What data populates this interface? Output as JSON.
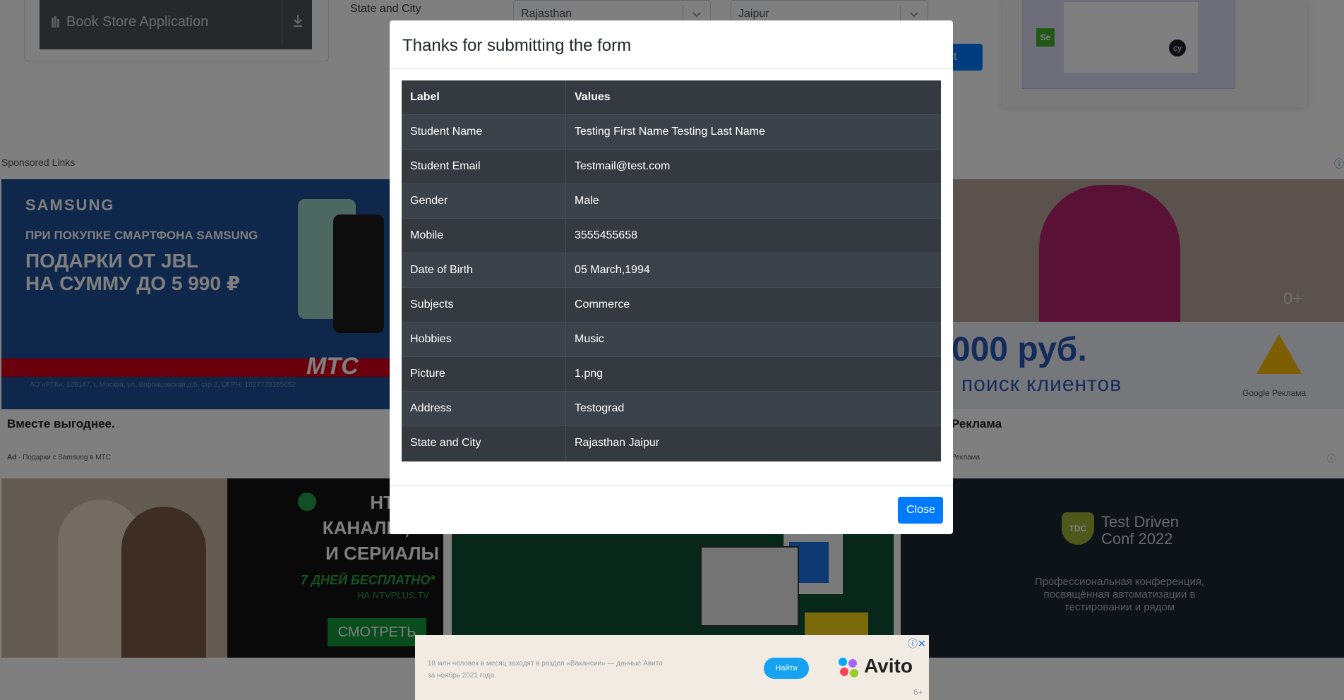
{
  "background": {
    "bookstore_label": "Book Store Application",
    "form_label": "State and City",
    "state_value": "Rajasthan",
    "city_value": "Jaipur",
    "submit_label": "mit",
    "sponsored_label": "Sponsored Links",
    "ads": {
      "samsung": {
        "brand": "SAMSUNG",
        "line1": "ПРИ ПОКУПКЕ СМАРТФОНА SAMSUNG",
        "line2": "ПОДАРКИ ОТ JBL",
        "line3": "НА СУММУ ДО 5 990 ₽",
        "mts": "МТС",
        "legal": "АО «РТК», 109147, г. Москва, ул. Воронцовская д.5, стр.2, ОГРН: 1027739165662",
        "title": "Вместе выгоднее.",
        "ad_tag": "Ad",
        "footer": "Подарки с Samsung в МТС"
      },
      "google": {
        "price": "000 руб.",
        "sub": "поиск клиентов",
        "logo_text": "Google Реклама",
        "zero_plus": "0+",
        "title": "Реклама",
        "footer": "Реклама"
      },
      "ntv": {
        "line1": "НТВ,ПЛ",
        "line2": "КАНАЛЫ, КИ",
        "line3": "И СЕРИАЛЫ",
        "free": "7 ДНЕЙ БЕСПЛАТНО*",
        "site": "НА NTVPLUS.TV",
        "button": "СМОТРЕТЬ"
      },
      "tdc": {
        "shield": "TDC",
        "title1": "Test Driven",
        "title2": "Conf 2022",
        "sub": "Профессиональная конференция, посвящённая автоматизации в тестировании и рядом"
      },
      "avito": {
        "text": "18 млн человек в месяц заходят в раздел «Вакансии» — данные Авито за ноябрь 2021 года.",
        "button": "Найти",
        "logo": "Avito",
        "age": "6+"
      }
    }
  },
  "modal": {
    "title": "Thanks for submitting the form",
    "table": {
      "headers": [
        "Label",
        "Values"
      ],
      "rows": [
        [
          "Student Name",
          "Testing First Name Testing Last Name"
        ],
        [
          "Student Email",
          "Testmail@test.com"
        ],
        [
          "Gender",
          "Male"
        ],
        [
          "Mobile",
          "3555455658"
        ],
        [
          "Date of Birth",
          "05 March,1994"
        ],
        [
          "Subjects",
          "Commerce"
        ],
        [
          "Hobbies",
          "Music"
        ],
        [
          "Picture",
          "1.png"
        ],
        [
          "Address",
          "Testograd"
        ],
        [
          "State and City",
          "Rajasthan Jaipur"
        ]
      ]
    },
    "close_label": "Close"
  },
  "colors": {
    "primary": "#007bff",
    "table_dark": "#343a40",
    "overlay": "rgba(0,0,0,0.5)"
  }
}
